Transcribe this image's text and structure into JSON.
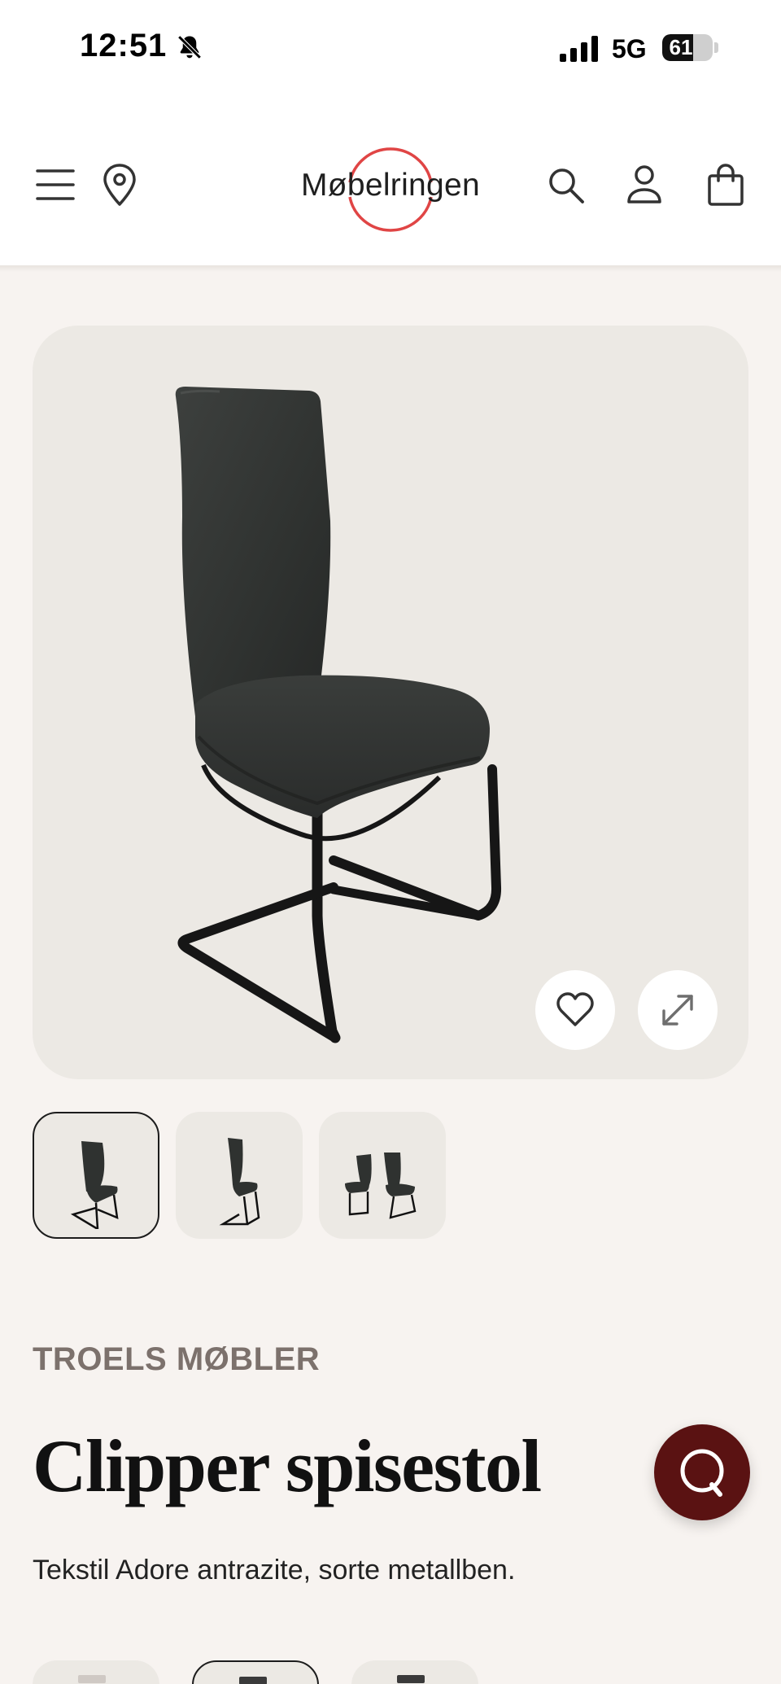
{
  "status_bar": {
    "time": "12:51",
    "network": "5G",
    "battery_level": "61",
    "battery_fraction": 0.61
  },
  "header": {
    "logo_text": "Møbelringen",
    "brand_color": "#e04545"
  },
  "gallery": {
    "image_count": 3,
    "active_index": 0
  },
  "product": {
    "brand": "TROELS MØBLER",
    "name": "Clipper spisestol",
    "description": "Tekstil Adore antrazite, sorte metallben."
  },
  "colors": {
    "background": "#f7f3f0",
    "image_background": "#ece9e4",
    "chat_button": "#5a1212",
    "brand_text": "#7c716c"
  },
  "icons": [
    "menu-icon",
    "location-pin-icon",
    "search-icon",
    "account-icon",
    "shopping-bag-icon",
    "heart-icon",
    "expand-icon",
    "chat-icon",
    "bell-muted-icon",
    "signal-icon",
    "battery-icon"
  ]
}
